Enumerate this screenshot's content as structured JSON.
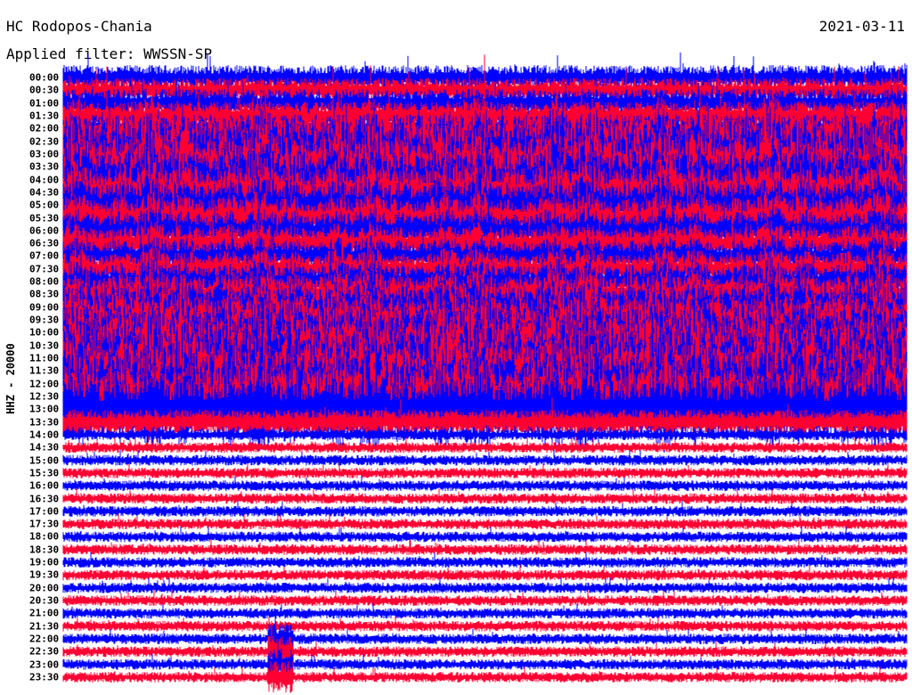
{
  "header": {
    "station": "HC Rodopos-Chania",
    "filter": "Applied filter: WWSSN-SP",
    "date": "2021-03-11"
  },
  "chart_data": {
    "type": "line",
    "title": "HC Rodopos-Chania",
    "subtitle": "Applied filter: WWSSN-SP",
    "date": "2021-03-11",
    "ylabel": "HHZ - 20000",
    "row_labels": [
      "00:00",
      "00:30",
      "01:00",
      "01:30",
      "02:00",
      "02:30",
      "03:00",
      "03:30",
      "04:00",
      "04:30",
      "05:00",
      "05:30",
      "06:00",
      "06:30",
      "07:00",
      "07:30",
      "08:00",
      "08:30",
      "09:00",
      "09:30",
      "10:00",
      "10:30",
      "11:00",
      "11:30",
      "12:00",
      "12:30",
      "13:00",
      "13:30",
      "14:00",
      "14:30",
      "15:00",
      "15:30",
      "16:00",
      "16:30",
      "17:00",
      "17:30",
      "18:00",
      "18:30",
      "19:00",
      "19:30",
      "20:00",
      "20:30",
      "21:00",
      "21:30",
      "22:00",
      "22:30",
      "23:00",
      "23:30"
    ],
    "row_minutes": 30,
    "colors": [
      "#0000ff",
      "#ff0033"
    ],
    "high_noise_rows_until": "13:30"
  }
}
